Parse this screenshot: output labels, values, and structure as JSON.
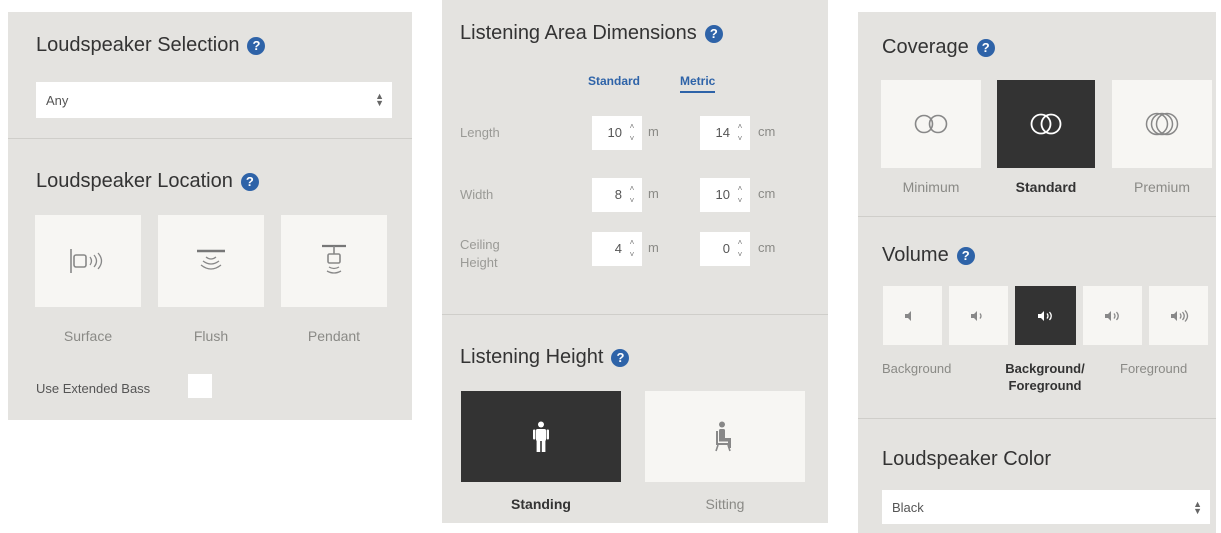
{
  "speaker_panel": {
    "selection_title": "Loudspeaker Selection",
    "selection_value": "Any",
    "location_title": "Loudspeaker Location",
    "locations": [
      {
        "label": "Surface",
        "icon": "surface-speaker-icon"
      },
      {
        "label": "Flush",
        "icon": "flush-speaker-icon"
      },
      {
        "label": "Pendant",
        "icon": "pendant-speaker-icon"
      }
    ],
    "extended_bass_label": "Use Extended Bass",
    "extended_bass_checked": false
  },
  "area_panel": {
    "title": "Listening Area Dimensions",
    "unit_tabs": [
      "Standard",
      "Metric"
    ],
    "active_unit": "Metric",
    "dimensions": [
      {
        "label": "Length",
        "major": "10",
        "major_unit": "m",
        "minor": "14",
        "minor_unit": "cm"
      },
      {
        "label": "Width",
        "major": "8",
        "major_unit": "m",
        "minor": "10",
        "minor_unit": "cm"
      },
      {
        "label": "Ceiling Height",
        "major": "4",
        "major_unit": "m",
        "minor": "0",
        "minor_unit": "cm"
      }
    ],
    "height_title": "Listening Height",
    "heights": [
      {
        "label": "Standing",
        "icon": "standing-person-icon",
        "active": true
      },
      {
        "label": "Sitting",
        "icon": "sitting-person-icon",
        "active": false
      }
    ]
  },
  "coverage_panel": {
    "coverage_title": "Coverage",
    "coverage_options": [
      {
        "label": "Minimum",
        "icon": "minimum-coverage-icon",
        "active": false
      },
      {
        "label": "Standard",
        "icon": "standard-coverage-icon",
        "active": true
      },
      {
        "label": "Premium",
        "icon": "premium-coverage-icon",
        "active": false
      }
    ],
    "volume_title": "Volume",
    "volume_labels": [
      {
        "label": "Background",
        "active": false
      },
      {
        "label": "Background/ Foreground",
        "active": true
      },
      {
        "label": "Foreground",
        "active": false
      }
    ],
    "volume_levels": 5,
    "volume_active_level": 3,
    "color_title": "Loudspeaker Color",
    "color_value": "Black"
  },
  "colors": {
    "panel_bg": "#e4e3e0",
    "tile_bg": "#f7f6f3",
    "active_tile": "#333333",
    "accent": "#2e63a8"
  }
}
